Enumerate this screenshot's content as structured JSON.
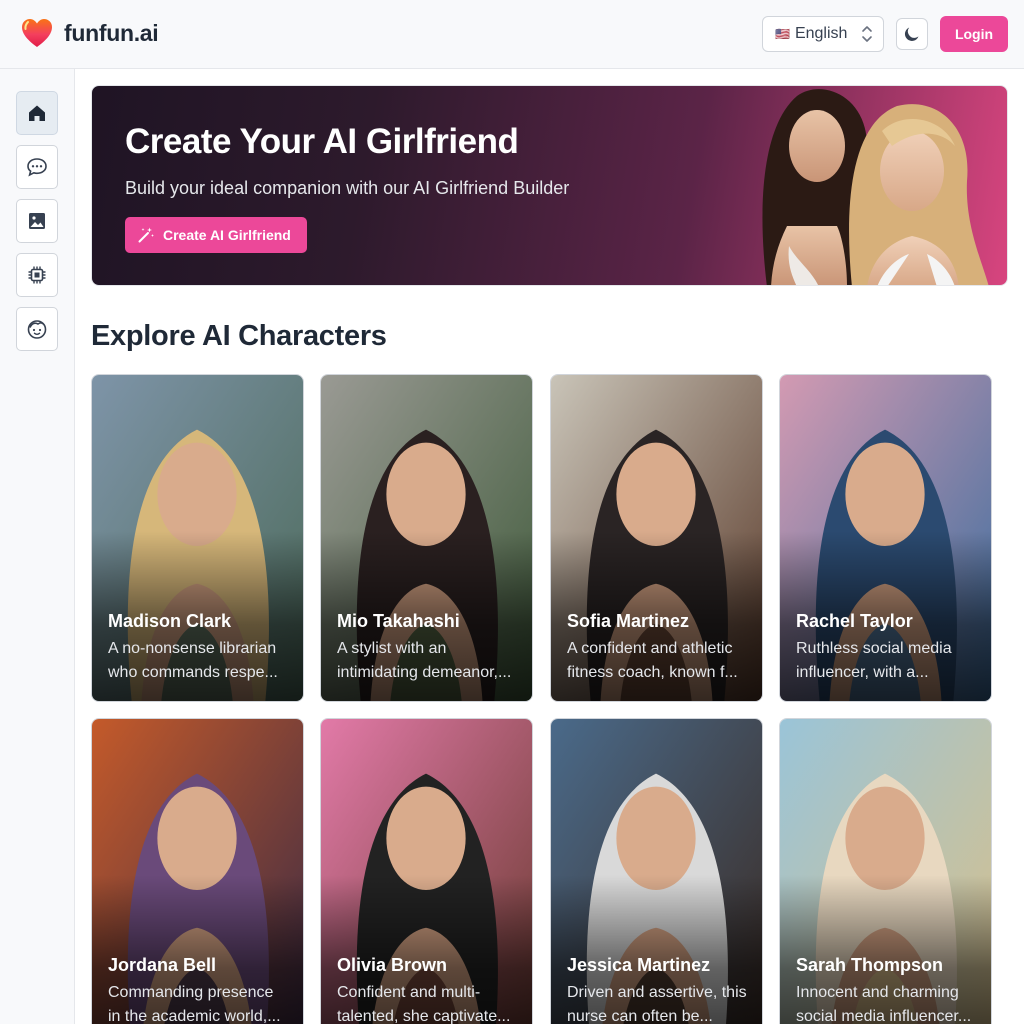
{
  "header": {
    "logo_text": "funfun.ai",
    "language": {
      "flag": "🇺🇸",
      "label": "English"
    },
    "login_label": "Login"
  },
  "sidebar": {
    "items": [
      {
        "name": "home",
        "icon": "home-icon",
        "active": true
      },
      {
        "name": "chat",
        "icon": "chat-bubble-icon",
        "active": false
      },
      {
        "name": "image",
        "icon": "image-icon",
        "active": false
      },
      {
        "name": "chip",
        "icon": "chip-icon",
        "active": false
      },
      {
        "name": "face",
        "icon": "face-icon",
        "active": false
      }
    ]
  },
  "banner": {
    "title": "Create Your AI Girlfriend",
    "subtitle": "Build your ideal companion with our AI Girlfriend Builder",
    "button_label": "Create AI Girlfriend"
  },
  "section_title": "Explore AI Characters",
  "characters": [
    {
      "name": "Madison Clark",
      "description": "A no-nonsense librarian who commands respe...",
      "colors": [
        "#7e94a8",
        "#4c6a5a",
        "#d6b77a"
      ]
    },
    {
      "name": "Mio Takahashi",
      "description": "A stylist with an intimidating demeanor,...",
      "colors": [
        "#9a9a94",
        "#3f5a3a",
        "#2a2020"
      ]
    },
    {
      "name": "Sofia Martinez",
      "description": "A confident and athletic fitness coach, known f...",
      "colors": [
        "#c9c4b8",
        "#5a3a2a",
        "#2a2424"
      ]
    },
    {
      "name": "Rachel Taylor",
      "description": "Ruthless social media influencer, with a...",
      "colors": [
        "#d39ab2",
        "#3b6d9e",
        "#2b4a70"
      ]
    },
    {
      "name": "Jordana Bell",
      "description": "Commanding presence in the academic world,...",
      "colors": [
        "#c45a2a",
        "#3a2a44",
        "#6a4a7a"
      ]
    },
    {
      "name": "Olivia Brown",
      "description": "Confident and multi-talented, she captivate...",
      "colors": [
        "#e27aa8",
        "#6a3a30",
        "#222222"
      ]
    },
    {
      "name": "Jessica Martinez",
      "description": "Driven and assertive, this nurse can often be...",
      "colors": [
        "#4a6a8a",
        "#3a2a22",
        "#d9d9d9"
      ]
    },
    {
      "name": "Sarah Thompson",
      "description": "Innocent and charming social media influencer...",
      "colors": [
        "#9ac4d8",
        "#d8c08a",
        "#e8d8c0"
      ]
    }
  ]
}
